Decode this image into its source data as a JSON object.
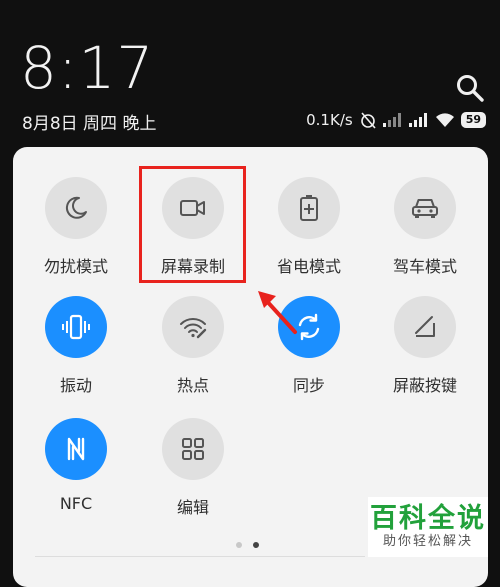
{
  "status": {
    "time": "8:17",
    "date": "8月8日 周四 晚上",
    "network_speed": "0.1K/s",
    "battery": "59"
  },
  "tiles": [
    {
      "label": "勿扰模式",
      "icon": "moon-icon",
      "active": false
    },
    {
      "label": "屏幕录制",
      "icon": "video-camera-icon",
      "active": false
    },
    {
      "label": "省电模式",
      "icon": "battery-saver-icon",
      "active": false
    },
    {
      "label": "驾车模式",
      "icon": "car-icon",
      "active": false
    },
    {
      "label": "振动",
      "icon": "vibrate-icon",
      "active": true
    },
    {
      "label": "热点",
      "icon": "hotspot-icon",
      "active": false
    },
    {
      "label": "同步",
      "icon": "sync-icon",
      "active": true
    },
    {
      "label": "屏蔽按键",
      "icon": "block-keys-icon",
      "active": false
    },
    {
      "label": "NFC",
      "icon": "nfc-icon",
      "active": true
    },
    {
      "label": "编辑",
      "icon": "edit-grid-icon",
      "active": false
    }
  ],
  "pager": {
    "pages": 2,
    "current": 2
  },
  "watermark": {
    "title": "百科全说",
    "subtitle": "助你轻松解决"
  },
  "colors": {
    "active": "#1b8fff",
    "inactive": "#e0e0e0",
    "highlight": "#e8221d"
  }
}
